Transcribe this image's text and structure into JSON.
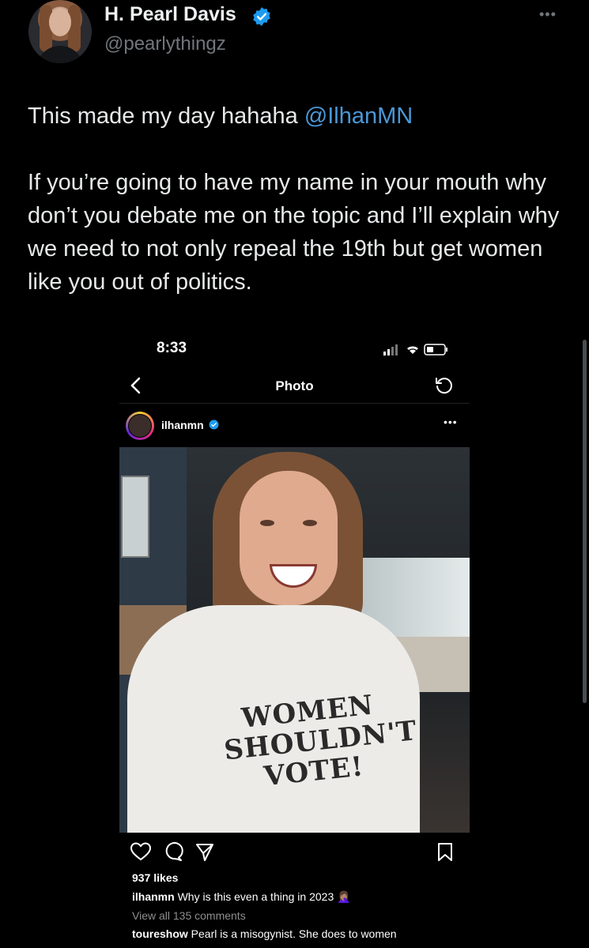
{
  "tweet": {
    "author_name": "H. Pearl Davis",
    "author_handle": "@pearlythingz",
    "more_label": "•••",
    "line1_text": "This made my day hahaha ",
    "line1_mention": "@IlhanMN",
    "paragraph2": "If you’re going to have my name in your mouth why don’t you debate me on the topic and I’ll explain why we need to not only repeal the 19th but get women like you out of politics."
  },
  "embedded": {
    "status_time": "8:33",
    "header_title": "Photo",
    "post_username": "ilhanmn",
    "more_label": "•••",
    "shirt_text": [
      "WOMEN",
      "SHOULDN'T",
      "VOTE!"
    ],
    "likes": "937 likes",
    "caption_user": "ilhanmn",
    "caption_text": "Why is this even a thing in 2023",
    "caption_emoji": "🤦🏽‍♀️",
    "view_all": "View all 135 comments",
    "comment_user": "toureshow",
    "comment_text": "Pearl is a misogynist. She does to women"
  },
  "colors": {
    "background": "#000000",
    "mention": "#4a98d8",
    "verified": "#1d9bf0",
    "muted": "#71767b"
  }
}
